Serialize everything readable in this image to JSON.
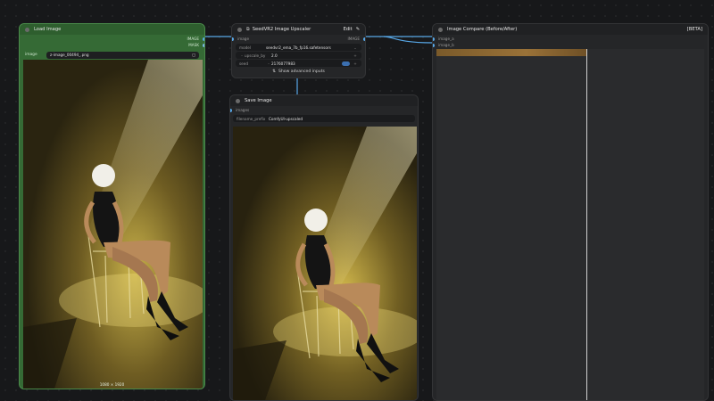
{
  "load_image": {
    "title": "Load Image",
    "outputs": [
      "IMAGE",
      "MASK"
    ],
    "field_label": "image",
    "field_value": "z-image_00494_.png",
    "size_label": "1080 × 1920"
  },
  "upscaler": {
    "title": "SeedVR2 Image Upscaler",
    "edit_label": "Edit",
    "input_port": "image",
    "output_port": "IMAGE",
    "fields": [
      {
        "label": "model",
        "value": "seedvr2_ema_7b_fp16.safetensors"
      },
      {
        "label": "upscale_by",
        "value": "2.0"
      },
      {
        "label": "seed",
        "value": "2176077983"
      }
    ],
    "advanced_label": "Show advanced inputs"
  },
  "save_image": {
    "title": "Save Image",
    "input_port": "images",
    "prefix_label": "filename_prefix",
    "prefix_value": "ComfyUI-upscaled"
  },
  "compare": {
    "title": "Image Compare (Before/After)",
    "badge": "[BETA]",
    "inputs": [
      "image_a",
      "image_b"
    ]
  },
  "colors": {
    "load_node": "#356a35",
    "wire": "#58a8e8",
    "node_bg": "#252628"
  }
}
